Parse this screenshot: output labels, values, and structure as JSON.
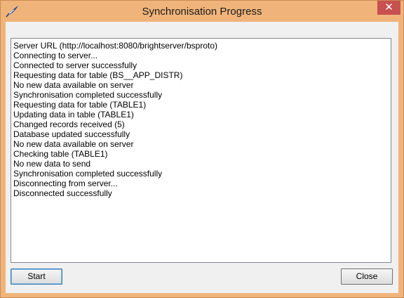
{
  "window": {
    "title": "Synchronisation Progress",
    "close_glyph": "✕",
    "icon": "app-feather-icon"
  },
  "log": {
    "lines": [
      "Server URL (http://localhost:8080/brightserver/bsproto)",
      "Connecting to server...",
      "Connected to server successfully",
      "Requesting data for table (BS__APP_DISTR)",
      "No new data available on server",
      "Synchronisation completed successfully",
      "Requesting data for table (TABLE1)",
      "Updating data in table (TABLE1)",
      "Changed records received (5)",
      "Database updated successfully",
      "No new data available on server",
      "Checking table (TABLE1)",
      "No new data to send",
      "Synchronisation completed successfully",
      "Disconnecting from server...",
      "Disconnected successfully"
    ]
  },
  "buttons": {
    "start_label": "Start",
    "close_label": "Close"
  },
  "colors": {
    "titlebar": "#f0b47b",
    "close_button": "#c75050",
    "client_background": "#f0f0f0"
  }
}
